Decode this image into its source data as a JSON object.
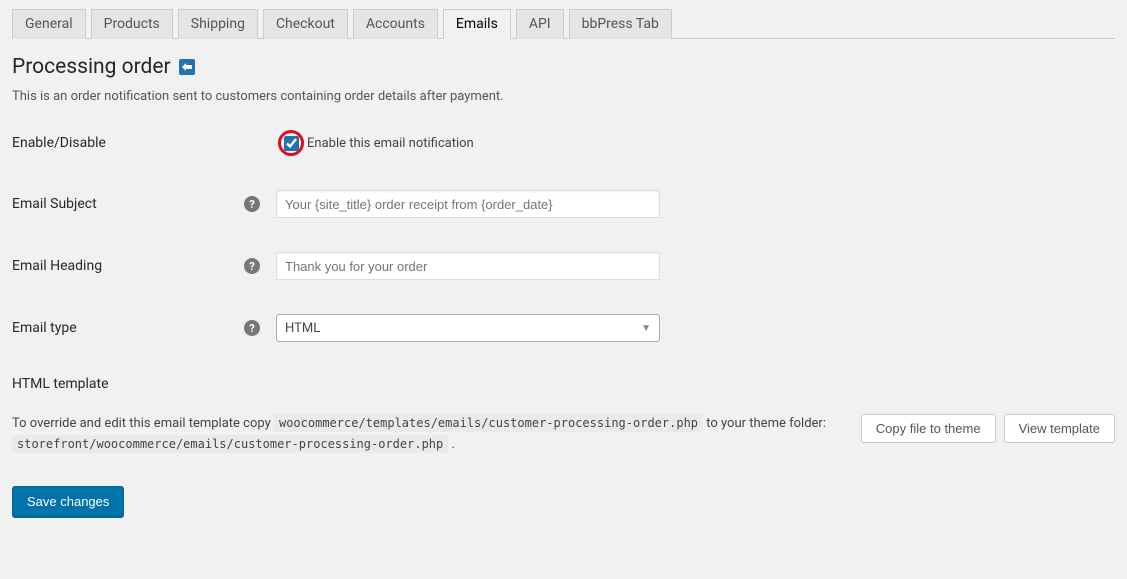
{
  "tabs": {
    "general": "General",
    "products": "Products",
    "shipping": "Shipping",
    "checkout": "Checkout",
    "accounts": "Accounts",
    "emails": "Emails",
    "api": "API",
    "bbpress": "bbPress Tab"
  },
  "page": {
    "title": "Processing order",
    "description": "This is an order notification sent to customers containing order details after payment."
  },
  "fields": {
    "enable_disable": {
      "label": "Enable/Disable",
      "checkbox_label": "Enable this email notification",
      "checked": true
    },
    "email_subject": {
      "label": "Email Subject",
      "placeholder": "Your {site_title} order receipt from {order_date}",
      "value": ""
    },
    "email_heading": {
      "label": "Email Heading",
      "placeholder": "Thank you for your order",
      "value": ""
    },
    "email_type": {
      "label": "Email type",
      "value": "HTML"
    }
  },
  "template": {
    "heading": "HTML template",
    "text_prefix": "To override and edit this email template copy ",
    "path1": "woocommerce/templates/emails/customer-processing-order.php",
    "text_mid": " to your theme folder: ",
    "path2": "storefront/woocommerce/emails/customer-processing-order.php",
    "text_suffix": " .",
    "copy_button": "Copy file to theme",
    "view_button": "View template"
  },
  "save_button": "Save changes"
}
